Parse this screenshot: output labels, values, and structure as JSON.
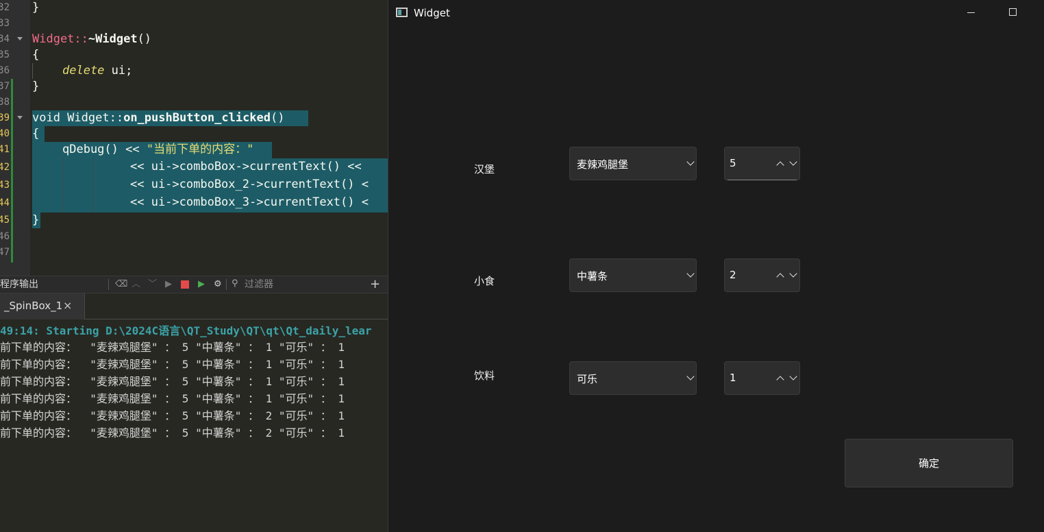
{
  "ide": {
    "line_numbers": [
      "32",
      "33",
      "34",
      "35",
      "36",
      "37",
      "38",
      "39",
      "40",
      "41",
      "42",
      "43",
      "44",
      "45",
      "46",
      "47"
    ],
    "code": {
      "l32": "}",
      "l34_class": "Widget",
      "l34_sep": "::",
      "l34_dtor": "~Widget",
      "l34_paren": "()",
      "l35": "{",
      "l36_delete": "delete",
      "l36_rest": " ui;",
      "l37": "}",
      "l39_void": "void Widget",
      "l39_sep": "::",
      "l39_fn": "on_pushButton_clicked",
      "l39_paren": "()",
      "l40": "{",
      "l41_pre": "qDebug() << ",
      "l41_str": "\"当前下单的内容：\"",
      "l42": "<< ui->comboBox->currentText() << ",
      "l43": "<< ui->comboBox_2->currentText() <",
      "l44": "<< ui->comboBox_3->currentText() <",
      "l45": "}"
    },
    "output_pane_title": "程序输出",
    "filter_placeholder": "过滤器",
    "add_icon_glyph": "+",
    "tab_label": "_SpinBox_1",
    "tab_close_glyph": "×",
    "output_start_line": "49:14: Starting D:\\2024C语言\\QT_Study\\QT\\qt\\Qt_daily_lear",
    "output_lines": [
      "前下单的内容：  \"麦辣鸡腿堡\" ： 5 \"中薯条\" ： 1 \"可乐\" ： 1",
      "前下单的内容：  \"麦辣鸡腿堡\" ： 5 \"中薯条\" ： 1 \"可乐\" ： 1",
      "前下单的内容：  \"麦辣鸡腿堡\" ： 5 \"中薯条\" ： 1 \"可乐\" ： 1",
      "前下单的内容：  \"麦辣鸡腿堡\" ： 5 \"中薯条\" ： 1 \"可乐\" ： 1",
      "前下单的内容：  \"麦辣鸡腿堡\" ： 5 \"中薯条\" ： 2 \"可乐\" ： 1",
      "前下单的内容：  \"麦辣鸡腿堡\" ： 5 \"中薯条\" ： 2 \"可乐\" ： 1"
    ]
  },
  "window": {
    "title": "Widget",
    "rows": [
      {
        "label": "汉堡",
        "combo_value": "麦辣鸡腿堡",
        "spin_value": "5"
      },
      {
        "label": "小食",
        "combo_value": "中薯条",
        "spin_value": "2"
      },
      {
        "label": "饮料",
        "combo_value": "可乐",
        "spin_value": "1"
      }
    ],
    "confirm_label": "确定"
  },
  "colors": {
    "selection": "#1d5c66",
    "class_name": "#f36c8a",
    "output_start": "#3ca3a8",
    "window_bg": "#1c1c1c",
    "control_bg": "#2d2d2d"
  }
}
